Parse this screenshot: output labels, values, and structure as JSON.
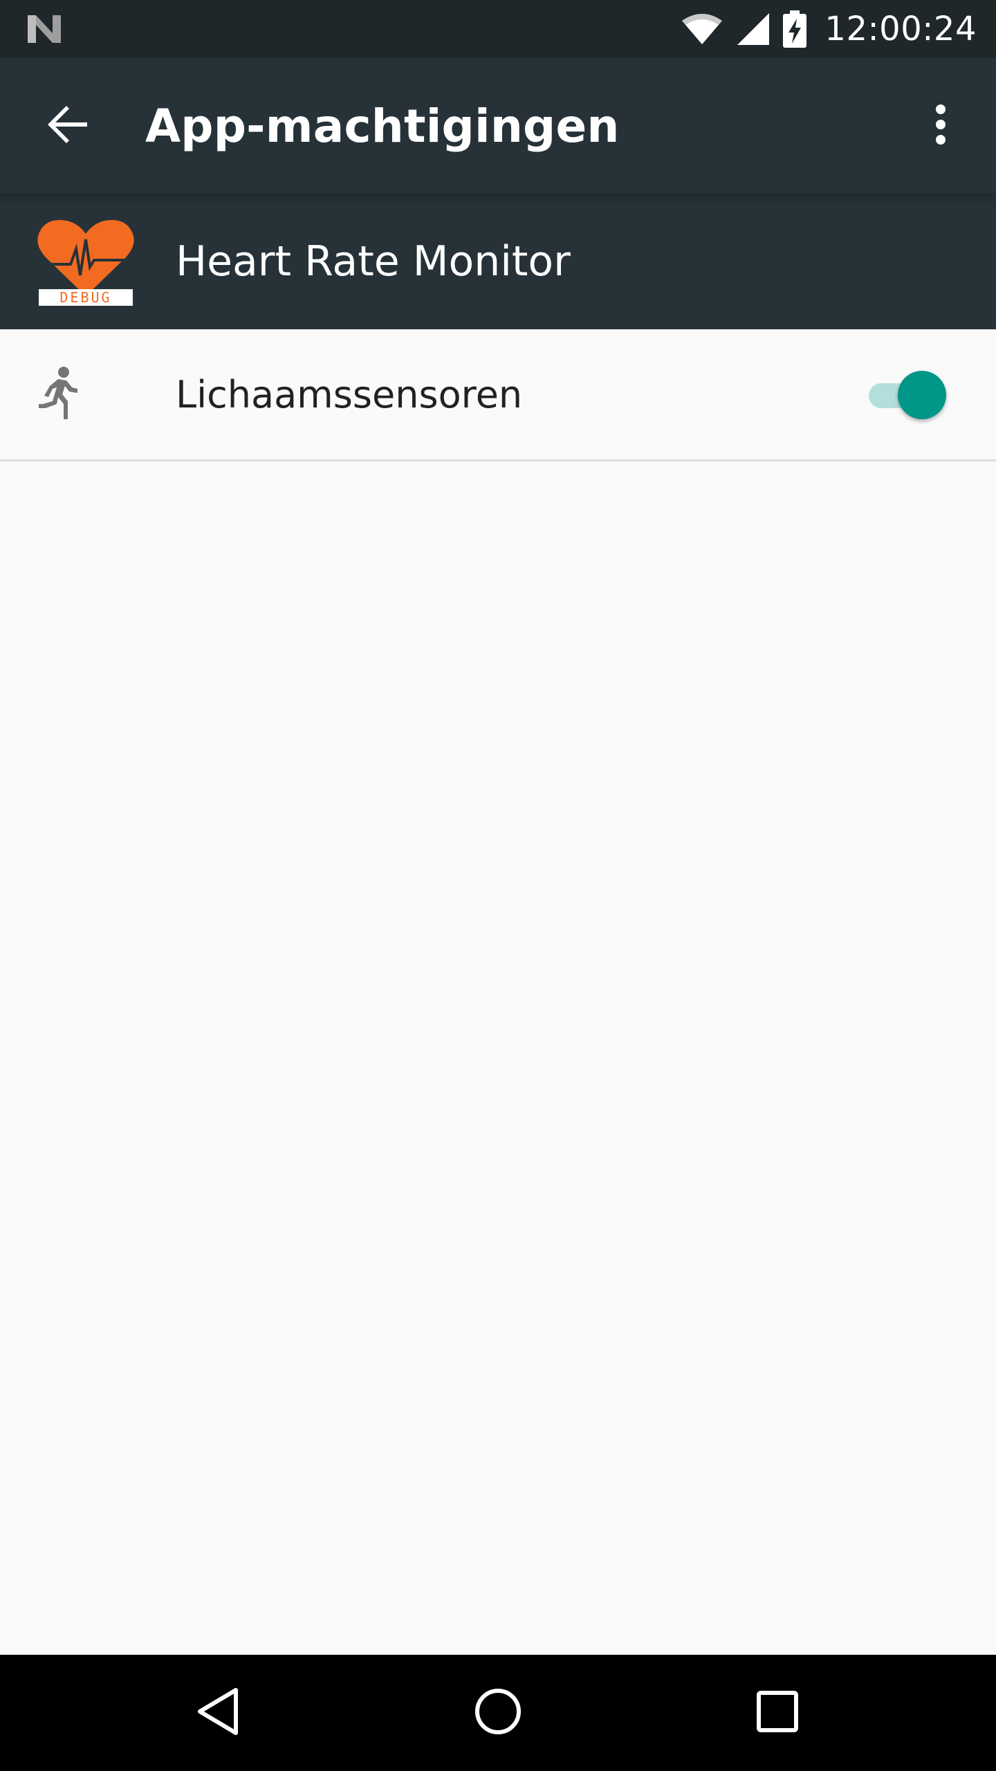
{
  "status_bar": {
    "time": "12:00:24",
    "left_icon": "android-n-logo-icon",
    "icons": [
      "wifi-icon",
      "signal-icon",
      "battery-charging-icon"
    ]
  },
  "app_bar": {
    "title": "App-machtigingen",
    "back_icon": "arrow-back-icon",
    "overflow_icon": "more-vert-icon"
  },
  "app_header": {
    "name": "Heart Rate Monitor",
    "icon": "heart-rate-app-icon",
    "icon_badge": "DEBUG"
  },
  "permissions": [
    {
      "label": "Lichaamssensoren",
      "icon": "running-person-icon",
      "enabled": true
    }
  ],
  "nav_bar": {
    "buttons": [
      "back-triangle-icon",
      "home-circle-icon",
      "recents-square-icon"
    ]
  },
  "colors": {
    "status_bar": "#1f272a",
    "app_bar": "#263238",
    "background": "#fafafa",
    "accent": "#009688",
    "accent_track": "#b2dfdb",
    "app_icon_orange": "#f26b21"
  }
}
